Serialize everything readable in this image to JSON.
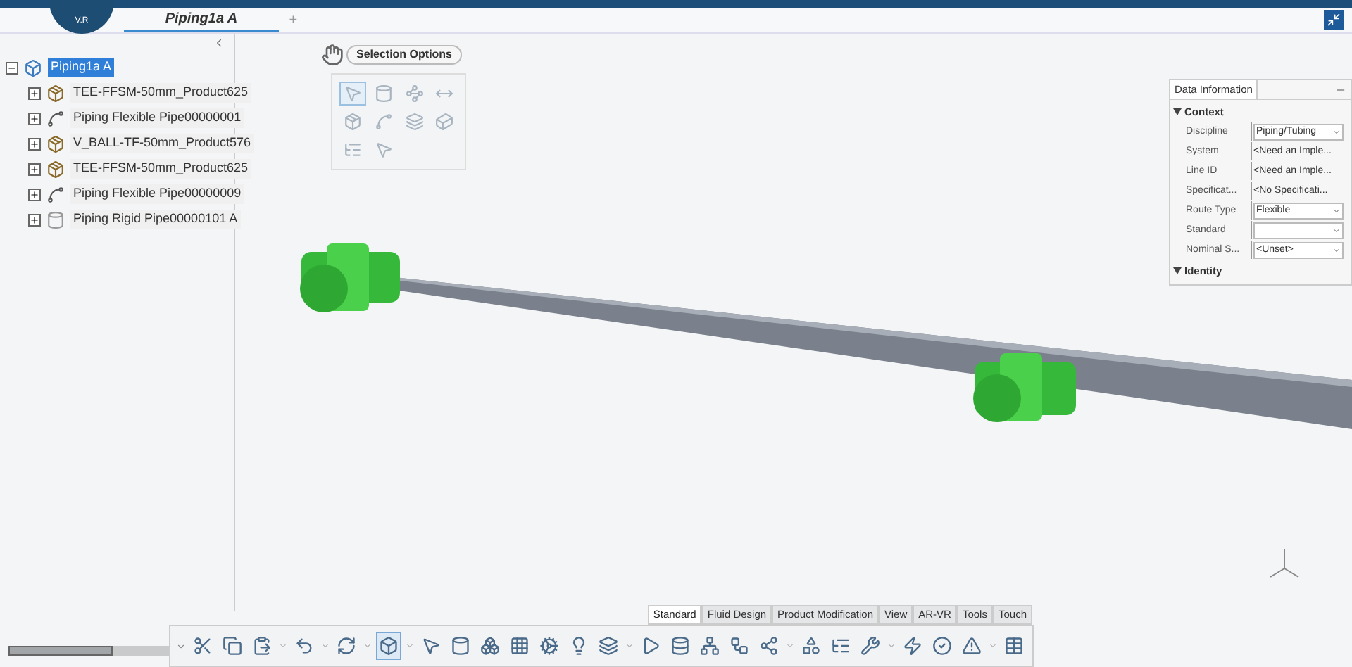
{
  "logo": {
    "text": "V.R"
  },
  "tabs": [
    {
      "label": "Piping1a A",
      "selected": true
    },
    {
      "label": "+",
      "selected": false
    }
  ],
  "tree": {
    "label": "Piping1a A",
    "kind": "product",
    "selected": true,
    "expanded": true,
    "children": [
      {
        "label": "TEE-FFSM-50mm_Product625",
        "kind": "fitting",
        "selected": false,
        "expanded": false
      },
      {
        "label": "Piping Flexible Pipe00000001",
        "kind": "flexible",
        "selected": false,
        "expanded": false
      },
      {
        "label": "V_BALL-TF-50mm_Product576",
        "kind": "fitting",
        "selected": false,
        "expanded": false
      },
      {
        "label": "TEE-FFSM-50mm_Product625",
        "kind": "fitting",
        "selected": false,
        "expanded": false
      },
      {
        "label": "Piping Flexible Pipe00000009",
        "kind": "flexible",
        "selected": false,
        "expanded": false
      },
      {
        "label": "Piping Rigid Pipe00000101 A",
        "kind": "rigid",
        "selected": false,
        "expanded": false
      }
    ]
  },
  "tree_scrollbar": {
    "level": 0.5
  },
  "selection_options": {
    "title": "Selection Options",
    "tools": [
      {
        "selected": true
      },
      {
        "selected": false
      },
      {
        "selected": false
      },
      {
        "selected": false
      },
      {
        "selected": false
      },
      {
        "selected": false
      },
      {
        "selected": false
      },
      {
        "selected": false
      },
      {
        "selected": false
      },
      {
        "selected": false
      }
    ]
  },
  "data_panel": {
    "title": "Data Information",
    "sections": [
      {
        "title": "Context",
        "expanded": true,
        "fields": [
          {
            "label": "Discipline",
            "kind": "combo",
            "value": "Piping/Tubing"
          },
          {
            "label": "System",
            "kind": "text",
            "value": "<Need an Imple..."
          },
          {
            "label": "Line ID",
            "kind": "text",
            "value": "<Need an Imple..."
          },
          {
            "label": "Specificat...",
            "kind": "text",
            "value": "<No Specificati..."
          },
          {
            "label": "Route Type",
            "kind": "combo",
            "value": "Flexible"
          },
          {
            "label": "Standard",
            "kind": "combo"
          },
          {
            "label": "Nominal S...",
            "kind": "combo",
            "value": "<Unset>"
          }
        ]
      },
      {
        "title": "Identity",
        "expanded": true
      }
    ]
  },
  "workbench_tabs": [
    {
      "label": "Standard",
      "selected": true
    },
    {
      "label": "Fluid Design",
      "selected": false
    },
    {
      "label": "Product Modification",
      "selected": false
    },
    {
      "label": "View",
      "selected": false
    },
    {
      "label": "AR-VR",
      "selected": false
    },
    {
      "label": "Tools",
      "selected": false
    },
    {
      "label": "Touch",
      "selected": false
    }
  ],
  "toolbar_buttons": [
    {
      "selected": false,
      "dropdown": false
    },
    {
      "selected": false,
      "dropdown": false
    },
    {
      "selected": false,
      "dropdown": true
    },
    {
      "selected": false,
      "dropdown": true
    },
    {
      "selected": false,
      "dropdown": true
    },
    {
      "selected": true,
      "dropdown": true
    },
    {
      "selected": false,
      "dropdown": false
    },
    {
      "selected": false,
      "dropdown": false
    },
    {
      "selected": false,
      "dropdown": false
    },
    {
      "selected": false,
      "dropdown": false
    },
    {
      "selected": false,
      "dropdown": false
    },
    {
      "selected": false,
      "dropdown": false
    },
    {
      "selected": false,
      "dropdown": true
    },
    {
      "selected": false,
      "dropdown": false
    },
    {
      "selected": false,
      "dropdown": false
    },
    {
      "selected": false,
      "dropdown": false
    },
    {
      "selected": false,
      "dropdown": false
    },
    {
      "selected": false,
      "dropdown": true
    },
    {
      "selected": false,
      "dropdown": false
    },
    {
      "selected": false,
      "dropdown": false
    },
    {
      "selected": false,
      "dropdown": true
    },
    {
      "selected": false,
      "dropdown": false
    },
    {
      "selected": false,
      "dropdown": false
    },
    {
      "selected": false,
      "dropdown": true
    },
    {
      "selected": false,
      "dropdown": false
    }
  ]
}
